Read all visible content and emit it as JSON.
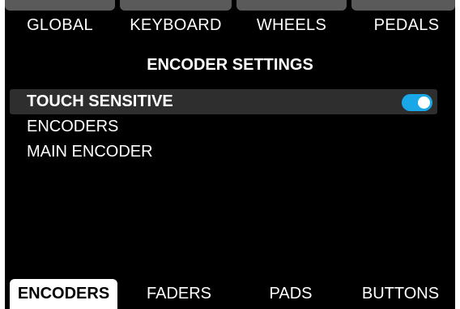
{
  "colors": {
    "background": "#000000",
    "text": "#ffffff",
    "tab_cap": "#5a5a5a",
    "selected_row": "#2e2e2e",
    "toggle_on": "#1aa7e8",
    "active_tab_bg": "#ffffff",
    "active_tab_text": "#000000"
  },
  "top_tabs": [
    {
      "label": "GLOBAL"
    },
    {
      "label": "KEYBOARD"
    },
    {
      "label": "WHEELS"
    },
    {
      "label": "PEDALS"
    }
  ],
  "title": "ENCODER SETTINGS",
  "menu": {
    "items": [
      {
        "label": "TOUCH SENSITIVE",
        "selected": true,
        "toggle": {
          "state": "on",
          "icon": "toggle-switch-icon"
        }
      },
      {
        "label": "ENCODERS",
        "selected": false
      },
      {
        "label": "MAIN ENCODER",
        "selected": false
      }
    ]
  },
  "bottom_tabs": [
    {
      "label": "ENCODERS",
      "active": true
    },
    {
      "label": "FADERS",
      "active": false
    },
    {
      "label": "PADS",
      "active": false
    },
    {
      "label": "BUTTONS",
      "active": false
    }
  ]
}
